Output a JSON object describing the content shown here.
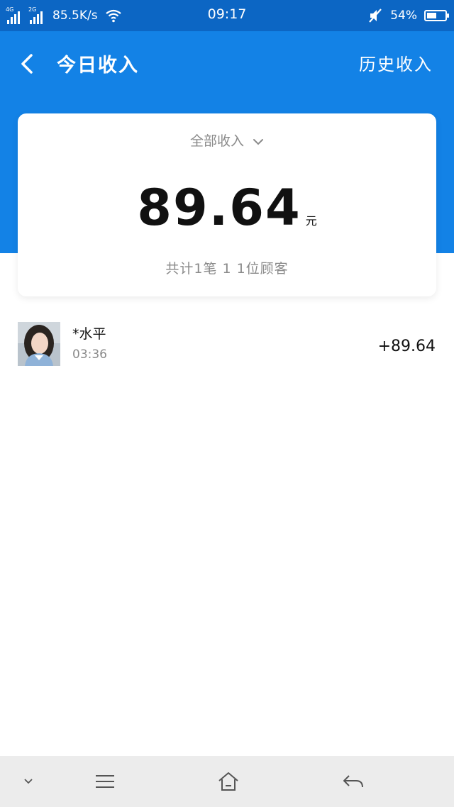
{
  "status_bar": {
    "sim1": "4G",
    "sim2": "2G",
    "net_speed": "85.5K/s",
    "time": "09:17",
    "battery_pct": "54%",
    "battery_level": 0.54
  },
  "header": {
    "title": "今日收入",
    "history_link": "历史收入"
  },
  "summary_card": {
    "filter_label": "全部收入",
    "total_amount": "89.64",
    "currency_unit": "元",
    "summary_text": "共计1笔 1 1位顾客"
  },
  "transactions": [
    {
      "payer_name": "*水平",
      "time": "03:36",
      "amount": "+89.64"
    }
  ],
  "colors": {
    "status_bar": "#0c66c4",
    "header": "#1382e6",
    "nav_bar": "#ececec"
  }
}
